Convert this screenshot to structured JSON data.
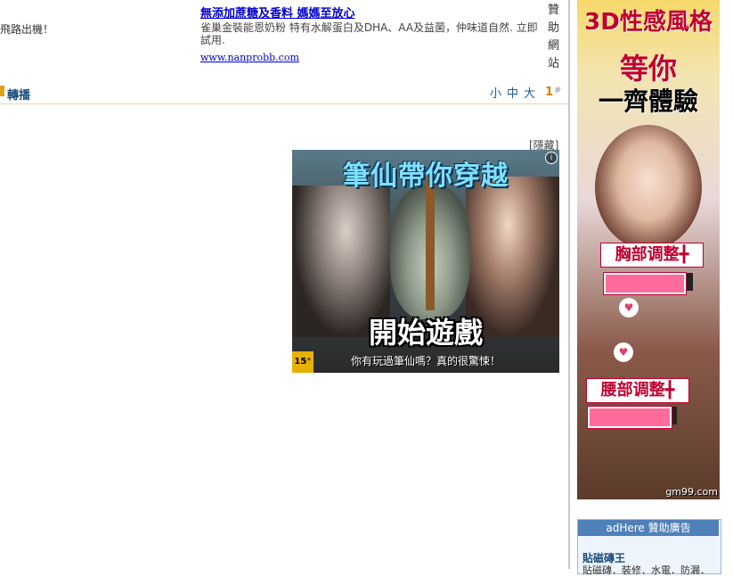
{
  "left_post": {
    "text": "飛路出機！"
  },
  "text_ad": {
    "title": "無添加蔗糖及香料 媽媽至放心",
    "description": "雀巢金裝能恩奶粉 特有水解蛋白及DHA、AA及益菌，仲味道自然. 立即試用.",
    "url": "www.nanprobb.com",
    "sponsor_chars": [
      "贊",
      "助",
      "網",
      "站"
    ]
  },
  "toolbar": {
    "share_label": "轉播",
    "font_sizes": [
      "小",
      "中",
      "大"
    ],
    "floor_number": "1",
    "floor_hash": "#"
  },
  "center_ad": {
    "hide_label": "[隱藏]",
    "title": "筆仙帶你穿越",
    "start_label": "開始遊戲",
    "tagline": "你有玩過筆仙嗎？真的很驚悚！",
    "rating": "15⁺",
    "info_icon": "info-icon"
  },
  "right_ad": {
    "headline_1": "3D性感風格",
    "headline_2": "等你",
    "headline_3": "一齊體驗",
    "label_chest": "胸部调整╋",
    "label_waist": "腰部调整╋",
    "bar_chest_fraction": 0.88,
    "bar_waist_fraction": 0.9,
    "domain": "gm99.com"
  },
  "adhere": {
    "header": "adHere 贊助廣告",
    "item_title": "貼磁磚王",
    "item_sub": "貼磁磚．裝修．水電．防漏．"
  },
  "colors": {
    "link": "#0000cc",
    "toolbar_blue": "#1e5c9e",
    "floor_orange": "#e07b00",
    "adhere_header": "#4f80b8"
  }
}
